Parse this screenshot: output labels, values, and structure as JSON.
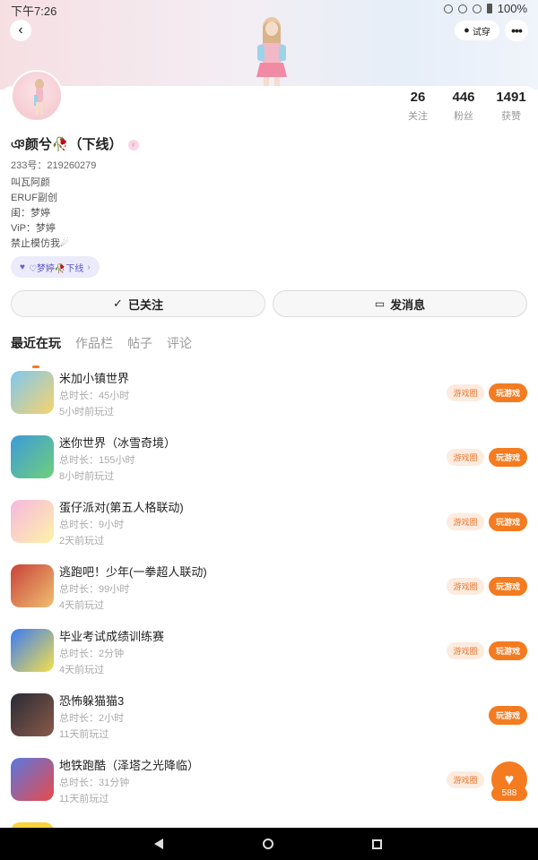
{
  "status_bar": {
    "time": "下午7:26",
    "battery": "100%"
  },
  "header": {
    "back_icon": "back-chevron-icon",
    "tryon_label": "试穿",
    "more_icon": "more-dots-icon"
  },
  "profile": {
    "stats": [
      {
        "value": "26",
        "label": "关注"
      },
      {
        "value": "446",
        "label": "粉丝"
      },
      {
        "value": "1491",
        "label": "获赞"
      }
    ],
    "nickname": "ঞ颜兮🥀（下线）",
    "uid": "233号：219260279",
    "bio": [
      "叫瓦阿颜",
      "ERUF副创",
      "闺：梦婷",
      "ViP：梦婷",
      "禁止模仿我☄"
    ],
    "tag": "♡梦婷🥀下线"
  },
  "actions": {
    "follow_label": "已关注",
    "message_label": "发消息"
  },
  "tabs": [
    "最近在玩",
    "作品栏",
    "帖子",
    "评论"
  ],
  "games": [
    {
      "name": "米加小镇世界",
      "duration": "总时长：45小时",
      "last_played": "5小时前玩过",
      "circle": "游戏圈",
      "play": "玩游戏",
      "colors": [
        "#7ec8f0",
        "#f7d36b"
      ]
    },
    {
      "name": "迷你世界（冰雪奇境）",
      "duration": "总时长：155小时",
      "last_played": "8小时前玩过",
      "circle": "游戏圈",
      "play": "玩游戏",
      "colors": [
        "#3d9ad8",
        "#6fd07a"
      ]
    },
    {
      "name": "蛋仔派对(第五人格联动)",
      "duration": "总时长：9小时",
      "last_played": "2天前玩过",
      "circle": "游戏圈",
      "play": "玩游戏",
      "colors": [
        "#f5b8e0",
        "#fff1a8"
      ]
    },
    {
      "name": "逃跑吧！少年(一拳超人联动)",
      "duration": "总时长：99小时",
      "last_played": "4天前玩过",
      "circle": "游戏圈",
      "play": "玩游戏",
      "colors": [
        "#c8423a",
        "#f0c070"
      ]
    },
    {
      "name": "毕业考试成绩训练赛",
      "duration": "总时长：2分钟",
      "last_played": "4天前玩过",
      "circle": "游戏圈",
      "play": "玩游戏",
      "colors": [
        "#3b7cf5",
        "#f4e04a"
      ]
    },
    {
      "name": "恐怖躲猫猫3",
      "duration": "总时长：2小时",
      "last_played": "11天前玩过",
      "circle": "",
      "play": "玩游戏",
      "colors": [
        "#2a2a35",
        "#8a5a4a"
      ]
    },
    {
      "name": "地铁跑酷（泽塔之光降临）",
      "duration": "总时长：31分钟",
      "last_played": "11天前玩过",
      "circle": "游戏圈",
      "play": "",
      "colors": [
        "#5a78e0",
        "#e84a4a"
      ]
    }
  ],
  "fab": {
    "count": "588"
  },
  "colors": {
    "accent": "#f47b20",
    "tag_bg": "#ecebfb"
  }
}
